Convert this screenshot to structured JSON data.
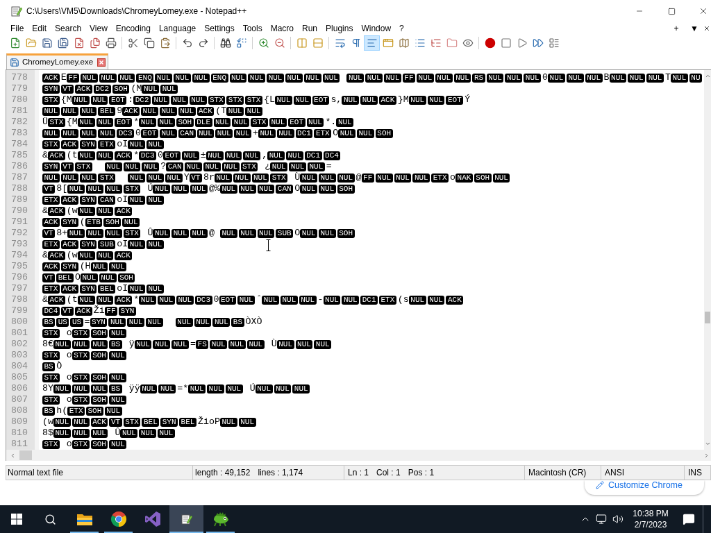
{
  "window": {
    "title": "C:\\Users\\VM5\\Downloads\\ChromeyLomey.exe - Notepad++"
  },
  "menu": [
    "File",
    "Edit",
    "Search",
    "View",
    "Encoding",
    "Language",
    "Settings",
    "Tools",
    "Macro",
    "Run",
    "Plugins",
    "Window",
    "?"
  ],
  "menu_right": [
    "+",
    "▼"
  ],
  "toolbar": [
    {
      "buttons": [
        {
          "pressed": false
        },
        {
          "pressed": false
        },
        {
          "pressed": false
        },
        {
          "pressed": false
        },
        {
          "pressed": false
        },
        {
          "pressed": false
        },
        {
          "pressed": false
        }
      ]
    },
    {
      "buttons": [
        {
          "pressed": false
        },
        {
          "pressed": false
        },
        {
          "pressed": false
        }
      ]
    },
    {
      "buttons": [
        {
          "pressed": false
        },
        {
          "pressed": false
        }
      ]
    },
    {
      "buttons": [
        {
          "pressed": false
        },
        {
          "pressed": false
        }
      ]
    },
    {
      "buttons": [
        {
          "pressed": false
        },
        {
          "pressed": false
        }
      ]
    },
    {
      "buttons": [
        {
          "pressed": false
        },
        {
          "pressed": false
        }
      ]
    },
    {
      "buttons": [
        {
          "pressed": false
        },
        {
          "pressed": false
        },
        {
          "pressed": true
        },
        {
          "pressed": false
        },
        {
          "pressed": false
        },
        {
          "pressed": false
        },
        {
          "pressed": false
        },
        {
          "pressed": false
        },
        {
          "pressed": false
        }
      ]
    },
    {
      "buttons": [
        {
          "pressed": false
        },
        {
          "pressed": false
        },
        {
          "pressed": false
        },
        {
          "pressed": false
        },
        {
          "pressed": false
        }
      ]
    }
  ],
  "tabs": [
    {
      "label": "ChromeyLomey.exe",
      "selected": true
    }
  ],
  "editor": {
    "lines": [
      {
        "number": "778",
        "tokens": [
          {
            "kind": "ctrl",
            "codes": [
              "ACK"
            ]
          },
          {
            "kind": "text",
            "text": "E"
          },
          {
            "kind": "ctrl",
            "codes": [
              "FF",
              "NUL",
              "NUL",
              "NUL",
              "ENQ",
              "NUL",
              "NUL",
              "NUL",
              "ENQ",
              "NUL",
              "NUL",
              "NUL",
              "NUL",
              "NUL",
              "NUL"
            ]
          },
          {
            "kind": "gap"
          },
          {
            "kind": "ctrl",
            "codes": [
              "NUL",
              "NUL",
              "NUL",
              "FF",
              "NUL",
              "NUL",
              "NUL",
              "RS",
              "NUL",
              "NUL",
              "NUL"
            ]
          },
          {
            "kind": "text",
            "text": "0"
          },
          {
            "kind": "ctrl",
            "codes": [
              "NUL",
              "NUL",
              "NUL"
            ]
          },
          {
            "kind": "text",
            "text": "B"
          },
          {
            "kind": "ctrl",
            "codes": [
              "NUL",
              "NUL",
              "NUL"
            ]
          },
          {
            "kind": "text",
            "text": "T"
          },
          {
            "kind": "ctrl",
            "codes": [
              "NUL",
              "NU"
            ]
          }
        ]
      },
      {
        "number": "779",
        "tokens": [
          {
            "kind": "ctrl",
            "codes": [
              "SYN",
              "VT",
              "ACK",
              "DC2",
              "SOH"
            ]
          },
          {
            "kind": "text",
            "text": "(M"
          },
          {
            "kind": "ctrl",
            "codes": [
              "NUL",
              "NUL"
            ]
          }
        ]
      },
      {
        "number": "780",
        "tokens": [
          {
            "kind": "ctrl",
            "codes": [
              "STX"
            ]
          },
          {
            "kind": "text",
            "text": "{M"
          },
          {
            "kind": "ctrl",
            "codes": [
              "NUL",
              "NUL",
              "EOT"
            ]
          },
          {
            "kind": "text",
            "text": ":"
          },
          {
            "kind": "ctrl",
            "codes": [
              "DC2",
              "NUL",
              "NUL",
              "NUL",
              "STX",
              "STX",
              "STX"
            ]
          },
          {
            "kind": "text",
            "text": "{L"
          },
          {
            "kind": "ctrl",
            "codes": [
              "NUL",
              "NUL",
              "EOT"
            ]
          },
          {
            "kind": "text",
            "text": "s,"
          },
          {
            "kind": "ctrl",
            "codes": [
              "NUL",
              "NUL",
              "ACK"
            ]
          },
          {
            "kind": "text",
            "text": "}M"
          },
          {
            "kind": "ctrl",
            "codes": [
              "NUL",
              "NUL",
              "EOT"
            ]
          },
          {
            "kind": "text",
            "text": "Ý"
          }
        ]
      },
      {
        "number": "781",
        "tokens": [
          {
            "kind": "ctrl",
            "codes": [
              "NUL",
              "NUL",
              "NUL",
              "BEL"
            ]
          },
          {
            "kind": "text",
            "text": "9"
          },
          {
            "kind": "ctrl",
            "codes": [
              "ACK",
              "NUL",
              "NUL",
              "NUL",
              "ACK"
            ]
          },
          {
            "kind": "text",
            "text": "(T"
          },
          {
            "kind": "ctrl",
            "codes": [
              "NUL",
              "NUL"
            ]
          }
        ]
      },
      {
        "number": "782",
        "tokens": [
          {
            "kind": "text",
            "text": "Ü"
          },
          {
            "kind": "ctrl",
            "codes": [
              "STX"
            ]
          },
          {
            "kind": "text",
            "text": "{M"
          },
          {
            "kind": "ctrl",
            "codes": [
              "NUL",
              "NUL",
              "EOT"
            ]
          },
          {
            "kind": "text",
            "text": "*"
          },
          {
            "kind": "ctrl",
            "codes": [
              "NUL",
              "NUL",
              "SOH",
              "DLE",
              "NUL",
              "NUL",
              "STX",
              "NUL",
              "EOT",
              "NUL"
            ]
          },
          {
            "kind": "text",
            "text": "*."
          },
          {
            "kind": "ctrl",
            "codes": [
              "NUL"
            ]
          }
        ]
      },
      {
        "number": "783",
        "tokens": [
          {
            "kind": "ctrl",
            "codes": [
              "NUL",
              "NUL",
              "NUL",
              "NUL",
              "DC3"
            ]
          },
          {
            "kind": "text",
            "text": "0"
          },
          {
            "kind": "ctrl",
            "codes": [
              "EOT",
              "NUL",
              "CAN",
              "NUL",
              "NUL",
              "NUL"
            ]
          },
          {
            "kind": "text",
            "text": "+"
          },
          {
            "kind": "ctrl",
            "codes": [
              "NUL",
              "NUL",
              "DC1",
              "ETX"
            ]
          },
          {
            "kind": "text",
            "text": "O"
          },
          {
            "kind": "ctrl",
            "codes": [
              "NUL",
              "NUL",
              "SOH"
            ]
          }
        ]
      },
      {
        "number": "784",
        "tokens": [
          {
            "kind": "ctrl",
            "codes": [
              "STX",
              "ACK",
              "SYN",
              "ETX"
            ]
          },
          {
            "kind": "text",
            "text": "oI"
          },
          {
            "kind": "ctrl",
            "codes": [
              "NUL",
              "NUL"
            ]
          }
        ]
      },
      {
        "number": "785",
        "tokens": [
          {
            "kind": "text",
            "text": "&"
          },
          {
            "kind": "ctrl",
            "codes": [
              "ACK"
            ]
          },
          {
            "kind": "text",
            "text": "(t"
          },
          {
            "kind": "ctrl",
            "codes": [
              "NUL",
              "NUL",
              "ACK"
            ]
          },
          {
            "kind": "text",
            "text": "*"
          },
          {
            "kind": "ctrl",
            "codes": [
              "DC3"
            ]
          },
          {
            "kind": "text",
            "text": "0"
          },
          {
            "kind": "ctrl",
            "codes": [
              "EOT",
              "NUL"
            ]
          },
          {
            "kind": "text",
            "text": "±"
          },
          {
            "kind": "ctrl",
            "codes": [
              "NUL",
              "NUL",
              "NUL"
            ]
          },
          {
            "kind": "text",
            "text": ","
          },
          {
            "kind": "ctrl",
            "codes": [
              "NUL",
              "NUL",
              "DC1",
              "DC4"
            ]
          }
        ]
      },
      {
        "number": "786",
        "tokens": [
          {
            "kind": "ctrl",
            "codes": [
              "SYN",
              "VT",
              "STX"
            ]
          },
          {
            "kind": "gap"
          },
          {
            "kind": "gap"
          },
          {
            "kind": "ctrl",
            "codes": [
              "NUL",
              "NUL",
              "NUL"
            ]
          },
          {
            "kind": "text",
            "text": "?"
          },
          {
            "kind": "ctrl",
            "codes": [
              "CAN",
              "NUL",
              "NUL",
              "NUL",
              "STX"
            ]
          },
          {
            "kind": "gap"
          },
          {
            "kind": "text",
            "text": "¿"
          },
          {
            "kind": "ctrl",
            "codes": [
              "NUL",
              "NUL",
              "NUL"
            ]
          },
          {
            "kind": "text",
            "text": "="
          }
        ]
      },
      {
        "number": "787",
        "tokens": [
          {
            "kind": "ctrl",
            "codes": [
              "NUL",
              "NUL",
              "NUL",
              "STX"
            ]
          },
          {
            "kind": "gap"
          },
          {
            "kind": "gap"
          },
          {
            "kind": "ctrl",
            "codes": [
              "NUL",
              "NUL",
              "NUL"
            ]
          },
          {
            "kind": "text",
            "text": "Y"
          },
          {
            "kind": "ctrl",
            "codes": [
              "VT"
            ]
          },
          {
            "kind": "text",
            "text": "8r"
          },
          {
            "kind": "ctrl",
            "codes": [
              "NUL",
              "NUL",
              "NUL",
              "STX"
            ]
          },
          {
            "kind": "gap"
          },
          {
            "kind": "text",
            "text": "Ù"
          },
          {
            "kind": "ctrl",
            "codes": [
              "NUL",
              "NUL",
              "NUL"
            ]
          },
          {
            "kind": "text",
            "text": "@"
          },
          {
            "kind": "ctrl",
            "codes": [
              "FF",
              "NUL",
              "NUL",
              "NUL",
              "ETX"
            ]
          },
          {
            "kind": "text",
            "text": "o"
          },
          {
            "kind": "ctrl",
            "codes": [
              "NAK",
              "SOH",
              "NUL"
            ]
          }
        ]
      },
      {
        "number": "788",
        "tokens": [
          {
            "kind": "ctrl",
            "codes": [
              "VT"
            ]
          },
          {
            "kind": "text",
            "text": "8["
          },
          {
            "kind": "ctrl",
            "codes": [
              "NUL",
              "NUL",
              "NUL",
              "STX"
            ]
          },
          {
            "kind": "gap"
          },
          {
            "kind": "text",
            "text": "Ú"
          },
          {
            "kind": "ctrl",
            "codes": [
              "NUL",
              "NUL",
              "NUL"
            ]
          },
          {
            "kind": "text",
            "text": "@%"
          },
          {
            "kind": "ctrl",
            "codes": [
              "NUL",
              "NUL",
              "NUL",
              "CAN"
            ]
          },
          {
            "kind": "text",
            "text": "O"
          },
          {
            "kind": "ctrl",
            "codes": [
              "NUL",
              "NUL",
              "SOH"
            ]
          }
        ]
      },
      {
        "number": "789",
        "tokens": [
          {
            "kind": "ctrl",
            "codes": [
              "ETX",
              "ACK",
              "SYN",
              "CAN"
            ]
          },
          {
            "kind": "text",
            "text": "oI"
          },
          {
            "kind": "ctrl",
            "codes": [
              "NUL",
              "NUL"
            ]
          }
        ]
      },
      {
        "number": "790",
        "tokens": [
          {
            "kind": "text",
            "text": "&"
          },
          {
            "kind": "ctrl",
            "codes": [
              "ACK"
            ]
          },
          {
            "kind": "text",
            "text": "(w"
          },
          {
            "kind": "ctrl",
            "codes": [
              "NUL",
              "NUL",
              "ACK"
            ]
          }
        ]
      },
      {
        "number": "791",
        "tokens": [
          {
            "kind": "ctrl",
            "codes": [
              "ACK",
              "SYN"
            ]
          },
          {
            "kind": "text",
            "text": "("
          },
          {
            "kind": "ctrl",
            "codes": [
              "ETB",
              "SOH",
              "NUL"
            ]
          }
        ]
      },
      {
        "number": "792",
        "tokens": [
          {
            "kind": "ctrl",
            "codes": [
              "VT"
            ]
          },
          {
            "kind": "text",
            "text": "8+"
          },
          {
            "kind": "ctrl",
            "codes": [
              "NUL",
              "NUL",
              "NUL",
              "STX"
            ]
          },
          {
            "kind": "gap"
          },
          {
            "kind": "text",
            "text": "Û"
          },
          {
            "kind": "ctrl",
            "codes": [
              "NUL",
              "NUL",
              "NUL"
            ]
          },
          {
            "kind": "text",
            "text": "@"
          },
          {
            "kind": "gap"
          },
          {
            "kind": "ctrl",
            "codes": [
              "NUL",
              "NUL",
              "NUL",
              "SUB"
            ]
          },
          {
            "kind": "text",
            "text": "O"
          },
          {
            "kind": "ctrl",
            "codes": [
              "NUL",
              "NUL",
              "SOH"
            ]
          }
        ]
      },
      {
        "number": "793",
        "tokens": [
          {
            "kind": "ctrl",
            "codes": [
              "ETX",
              "ACK",
              "SYN",
              "SUB"
            ]
          },
          {
            "kind": "text",
            "text": "oI"
          },
          {
            "kind": "ctrl",
            "codes": [
              "NUL",
              "NUL"
            ]
          }
        ]
      },
      {
        "number": "794",
        "tokens": [
          {
            "kind": "text",
            "text": "&"
          },
          {
            "kind": "ctrl",
            "codes": [
              "ACK"
            ]
          },
          {
            "kind": "text",
            "text": "(w"
          },
          {
            "kind": "ctrl",
            "codes": [
              "NUL",
              "NUL",
              "ACK"
            ]
          }
        ]
      },
      {
        "number": "795",
        "tokens": [
          {
            "kind": "ctrl",
            "codes": [
              "ACK",
              "SYN"
            ]
          },
          {
            "kind": "text",
            "text": "(H"
          },
          {
            "kind": "ctrl",
            "codes": [
              "NUL",
              "NUL"
            ]
          }
        ]
      },
      {
        "number": "796",
        "tokens": [
          {
            "kind": "ctrl",
            "codes": [
              "VT",
              "BEL"
            ]
          },
          {
            "kind": "text",
            "text": "O"
          },
          {
            "kind": "ctrl",
            "codes": [
              "NUL",
              "NUL",
              "SOH"
            ]
          }
        ]
      },
      {
        "number": "797",
        "tokens": [
          {
            "kind": "ctrl",
            "codes": [
              "ETX",
              "ACK",
              "SYN",
              "BEL"
            ]
          },
          {
            "kind": "text",
            "text": "oI"
          },
          {
            "kind": "ctrl",
            "codes": [
              "NUL",
              "NUL"
            ]
          }
        ]
      },
      {
        "number": "798",
        "tokens": [
          {
            "kind": "text",
            "text": "&"
          },
          {
            "kind": "ctrl",
            "codes": [
              "ACK"
            ]
          },
          {
            "kind": "text",
            "text": "(t"
          },
          {
            "kind": "ctrl",
            "codes": [
              "NUL",
              "NUL",
              "ACK"
            ]
          },
          {
            "kind": "text",
            "text": "*"
          },
          {
            "kind": "ctrl",
            "codes": [
              "NUL",
              "NUL",
              "NUL",
              "DC3"
            ]
          },
          {
            "kind": "text",
            "text": "0"
          },
          {
            "kind": "ctrl",
            "codes": [
              "EOT",
              "NUL"
            ]
          },
          {
            "kind": "text",
            "text": "ˆ"
          },
          {
            "kind": "ctrl",
            "codes": [
              "NUL",
              "NUL",
              "NUL"
            ]
          },
          {
            "kind": "text",
            "text": "-"
          },
          {
            "kind": "ctrl",
            "codes": [
              "NUL",
              "NUL",
              "DC1",
              "ETX"
            ]
          },
          {
            "kind": "text",
            "text": "(s"
          },
          {
            "kind": "ctrl",
            "codes": [
              "NUL",
              "NUL",
              "ACK"
            ]
          }
        ]
      },
      {
        "number": "799",
        "tokens": [
          {
            "kind": "ctrl",
            "codes": [
              "DC4",
              "VT",
              "ACK"
            ]
          },
          {
            "kind": "text",
            "text": "Ži"
          },
          {
            "kind": "ctrl",
            "codes": [
              "FF",
              "SYN"
            ]
          }
        ]
      },
      {
        "number": "800",
        "tokens": [
          {
            "kind": "ctrl",
            "codes": [
              "BS",
              "US",
              "US"
            ]
          },
          {
            "kind": "text",
            "text": "="
          },
          {
            "kind": "ctrl",
            "codes": [
              "SYN",
              "NUL",
              "NUL",
              "NUL"
            ]
          },
          {
            "kind": "gap"
          },
          {
            "kind": "gap"
          },
          {
            "kind": "ctrl",
            "codes": [
              "NUL",
              "NUL",
              "NUL",
              "BS"
            ]
          },
          {
            "kind": "text",
            "text": "ÒXÒ"
          }
        ]
      },
      {
        "number": "801",
        "tokens": [
          {
            "kind": "ctrl",
            "codes": [
              "STX"
            ]
          },
          {
            "kind": "gap"
          },
          {
            "kind": "text",
            "text": "o"
          },
          {
            "kind": "ctrl",
            "codes": [
              "STX",
              "SOH",
              "NUL"
            ]
          }
        ]
      },
      {
        "number": "802",
        "tokens": [
          {
            "kind": "text",
            "text": "8€"
          },
          {
            "kind": "ctrl",
            "codes": [
              "NUL",
              "NUL",
              "NUL",
              "BS"
            ]
          },
          {
            "kind": "gap"
          },
          {
            "kind": "text",
            "text": "ÿ"
          },
          {
            "kind": "ctrl",
            "codes": [
              "NUL",
              "NUL",
              "NUL"
            ]
          },
          {
            "kind": "text",
            "text": "="
          },
          {
            "kind": "ctrl",
            "codes": [
              "FS",
              "NUL",
              "NUL",
              "NUL"
            ]
          },
          {
            "kind": "gap"
          },
          {
            "kind": "text",
            "text": "Ù"
          },
          {
            "kind": "ctrl",
            "codes": [
              "NUL",
              "NUL",
              "NUL"
            ]
          }
        ]
      },
      {
        "number": "803",
        "tokens": [
          {
            "kind": "ctrl",
            "codes": [
              "STX"
            ]
          },
          {
            "kind": "gap"
          },
          {
            "kind": "text",
            "text": "o"
          },
          {
            "kind": "ctrl",
            "codes": [
              "STX",
              "SOH",
              "NUL"
            ]
          }
        ]
      },
      {
        "number": "804",
        "tokens": [
          {
            "kind": "ctrl",
            "codes": [
              "BS"
            ]
          },
          {
            "kind": "text",
            "text": "Ò"
          }
        ]
      },
      {
        "number": "805",
        "tokens": [
          {
            "kind": "ctrl",
            "codes": [
              "STX"
            ]
          },
          {
            "kind": "gap"
          },
          {
            "kind": "text",
            "text": "o"
          },
          {
            "kind": "ctrl",
            "codes": [
              "STX",
              "SOH",
              "NUL"
            ]
          }
        ]
      },
      {
        "number": "806",
        "tokens": [
          {
            "kind": "text",
            "text": "8Y"
          },
          {
            "kind": "ctrl",
            "codes": [
              "NUL",
              "NUL",
              "NUL",
              "BS"
            ]
          },
          {
            "kind": "gap"
          },
          {
            "kind": "text",
            "text": "ÿÿ"
          },
          {
            "kind": "ctrl",
            "codes": [
              "NUL",
              "NUL"
            ]
          },
          {
            "kind": "text",
            "text": "=*"
          },
          {
            "kind": "ctrl",
            "codes": [
              "NUL",
              "NUL",
              "NUL"
            ]
          },
          {
            "kind": "gap"
          },
          {
            "kind": "text",
            "text": "Ú"
          },
          {
            "kind": "ctrl",
            "codes": [
              "NUL",
              "NUL",
              "NUL"
            ]
          }
        ]
      },
      {
        "number": "807",
        "tokens": [
          {
            "kind": "ctrl",
            "codes": [
              "STX"
            ]
          },
          {
            "kind": "gap"
          },
          {
            "kind": "text",
            "text": "o"
          },
          {
            "kind": "ctrl",
            "codes": [
              "STX",
              "SOH",
              "NUL"
            ]
          }
        ]
      },
      {
        "number": "808",
        "tokens": [
          {
            "kind": "ctrl",
            "codes": [
              "BS"
            ]
          },
          {
            "kind": "text",
            "text": "h("
          },
          {
            "kind": "ctrl",
            "codes": [
              "ETX",
              "SOH",
              "NUL"
            ]
          }
        ]
      },
      {
        "number": "809",
        "tokens": [
          {
            "kind": "text",
            "text": "(w"
          },
          {
            "kind": "ctrl",
            "codes": [
              "NUL",
              "NUL",
              "ACK",
              "VT",
              "STX",
              "BEL",
              "SYN",
              "BEL"
            ]
          },
          {
            "kind": "text",
            "text": "ŽioP"
          },
          {
            "kind": "ctrl",
            "codes": [
              "NUL",
              "NUL"
            ]
          }
        ]
      },
      {
        "number": "810",
        "tokens": [
          {
            "kind": "text",
            "text": "8$"
          },
          {
            "kind": "ctrl",
            "codes": [
              "NUL",
              "NUL",
              "NUL"
            ]
          },
          {
            "kind": "gap"
          },
          {
            "kind": "text",
            "text": "Û"
          },
          {
            "kind": "ctrl",
            "codes": [
              "NUL",
              "NUL",
              "NUL"
            ]
          }
        ]
      },
      {
        "number": "811",
        "tokens": [
          {
            "kind": "ctrl",
            "codes": [
              "STX"
            ]
          },
          {
            "kind": "gap"
          },
          {
            "kind": "text",
            "text": "o"
          },
          {
            "kind": "ctrl",
            "codes": [
              "STX",
              "SOH",
              "NUL"
            ]
          }
        ]
      }
    ]
  },
  "status_bar": {
    "file_type": "Normal text file",
    "length": "length : 49,152",
    "lines": "lines : 1,174",
    "line": "Ln : 1",
    "column": "Col : 1",
    "position": "Pos : 1",
    "eol": "Macintosh (CR)",
    "encoding": "ANSI",
    "mode": "INS"
  },
  "background_page": {
    "button": "Customize Chrome"
  },
  "taskbar": {
    "apps": [
      {
        "running": true,
        "selected": false
      },
      {
        "running": true,
        "selected": false
      },
      {
        "running": false,
        "selected": false
      },
      {
        "running": true,
        "selected": true
      },
      {
        "running": true,
        "selected": false
      }
    ],
    "time": "10:38 PM",
    "date": "2/7/2023"
  }
}
